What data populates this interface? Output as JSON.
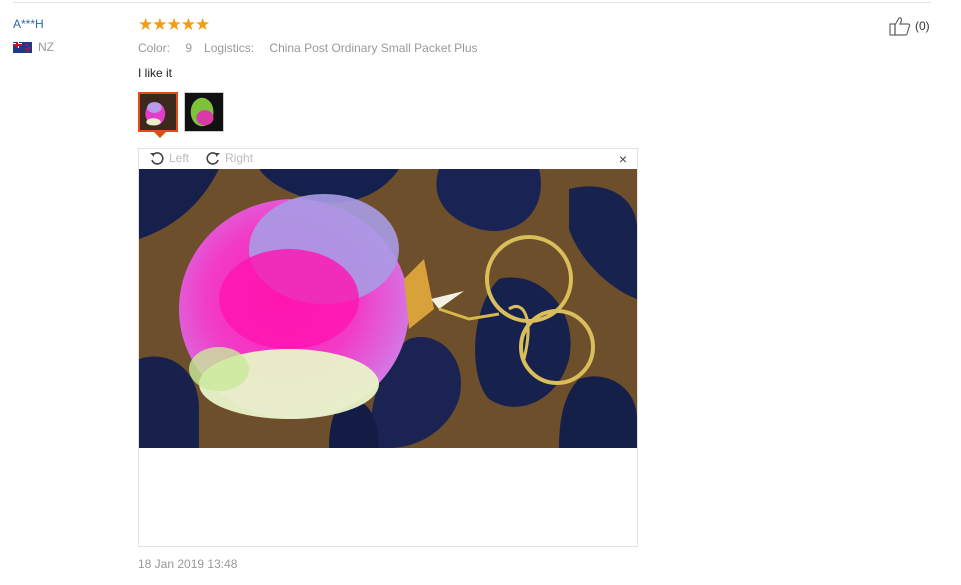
{
  "review": {
    "user_name": "A***H",
    "country": "NZ",
    "rating_stars": "★★★★★",
    "rating": 5,
    "color_label": "Color:",
    "color_value": "9",
    "logistics_label": "Logistics:",
    "logistics_value": "China Post Ordinary Small Packet Plus",
    "text": "I like it",
    "helpful_count": "(0)",
    "date": "18 Jan 2019 13:48"
  },
  "viewer": {
    "rotate_left_label": "Left",
    "rotate_right_label": "Right",
    "close_symbol": "×"
  },
  "colors": {
    "username": "#2a6aa8",
    "stars": "#f39c12",
    "active_thumb_border": "#e64a19"
  },
  "icons": [
    "thumbs-up-icon",
    "rotate-left-icon",
    "rotate-right-icon",
    "close-icon",
    "nz-flag-icon"
  ]
}
